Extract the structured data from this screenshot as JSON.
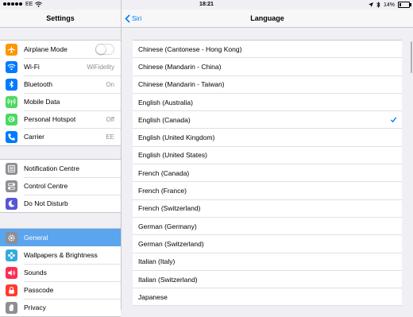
{
  "status": {
    "carrier": "EE",
    "time": "18:21",
    "battery": "14%",
    "battery_level": 0.14
  },
  "left": {
    "title": "Settings",
    "groups": [
      [
        {
          "label": "Airplane Mode",
          "icon": "airplane-icon",
          "color": "#ff9500",
          "toggle": true
        },
        {
          "label": "Wi-Fi",
          "value": "WiFidelity",
          "icon": "wifi-icon",
          "color": "#007aff"
        },
        {
          "label": "Bluetooth",
          "value": "On",
          "icon": "bluetooth-icon",
          "color": "#007aff"
        },
        {
          "label": "Mobile Data",
          "icon": "antenna-icon",
          "color": "#4cd964"
        },
        {
          "label": "Personal Hotspot",
          "value": "Off",
          "icon": "hotspot-icon",
          "color": "#4cd964"
        },
        {
          "label": "Carrier",
          "value": "EE",
          "icon": "phone-icon",
          "color": "#007aff"
        }
      ],
      [
        {
          "label": "Notification Centre",
          "icon": "notification-icon",
          "color": "#8e8e93"
        },
        {
          "label": "Control Centre",
          "icon": "switches-icon",
          "color": "#8e8e93"
        },
        {
          "label": "Do Not Disturb",
          "icon": "moon-icon",
          "color": "#5856d6"
        }
      ],
      [
        {
          "label": "General",
          "icon": "gear-icon",
          "color": "#8e8e93",
          "selected": true
        },
        {
          "label": "Wallpapers & Brightness",
          "icon": "flower-icon",
          "color": "#34aadc"
        },
        {
          "label": "Sounds",
          "icon": "speaker-icon",
          "color": "#ff2d55"
        },
        {
          "label": "Passcode",
          "icon": "lock-icon",
          "color": "#ff3b30"
        },
        {
          "label": "Privacy",
          "icon": "hand-icon",
          "color": "#8e8e93"
        }
      ]
    ]
  },
  "right": {
    "back_label": "Siri",
    "title": "Language",
    "selected": "English (Canada)",
    "languages": [
      "Chinese (Cantonese - Hong Kong)",
      "Chinese (Mandarin - China)",
      "Chinese (Mandarin - Taiwan)",
      "English (Australia)",
      "English (Canada)",
      "English (United Kingdom)",
      "English (United States)",
      "French (Canada)",
      "French (France)",
      "French (Switzerland)",
      "German (Germany)",
      "German (Switzerland)",
      "Italian (Italy)",
      "Italian (Switzerland)",
      "Japanese"
    ]
  }
}
